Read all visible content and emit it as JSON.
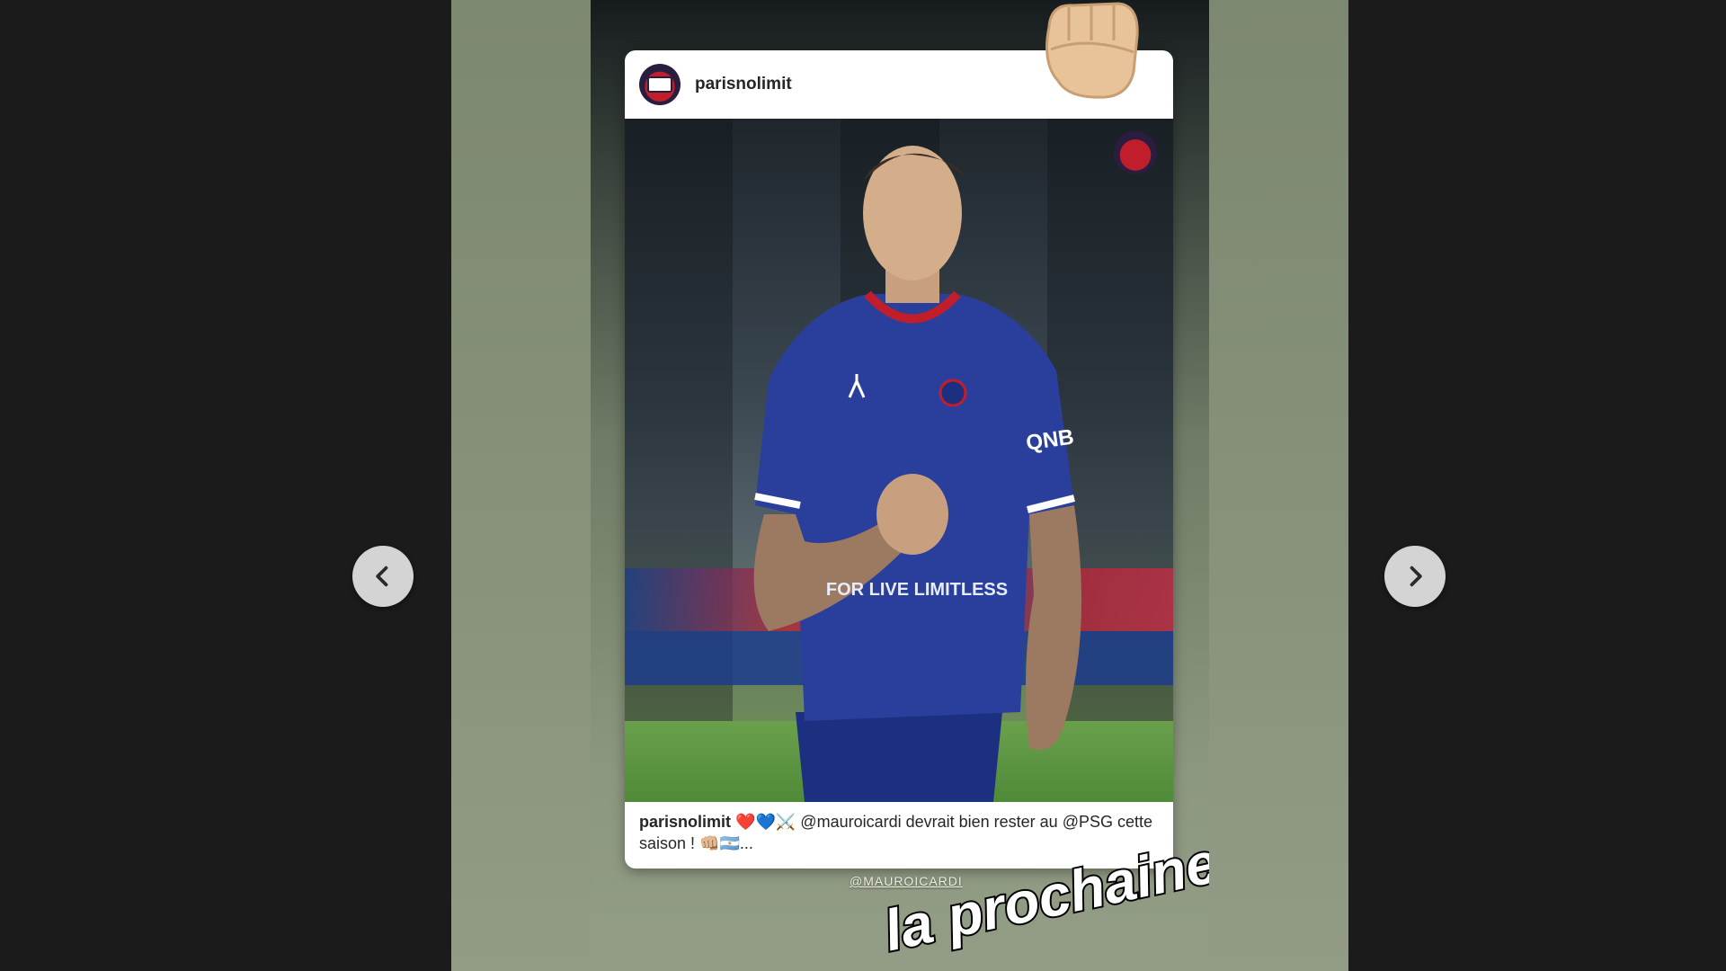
{
  "story": {
    "post": {
      "username": "parisnolimit",
      "caption_user": "parisnolimit",
      "caption_emojis_start": "❤️💙⚔️",
      "caption_text": "@mauroicardi devrait bien rester au @PSG cette saison !",
      "caption_emojis_end": "👊🏼🇦🇷...",
      "jersey_sponsor": "FOR LIVE LIMITLESS",
      "sleeve_sponsor": "QNB"
    },
    "mention_tag": "@MAUROICARDI",
    "sticker_text": "la prochaine",
    "fist_emoji": "👊🏼"
  },
  "navigation": {
    "prev_icon": "chevron-left-icon",
    "next_icon": "chevron-right-icon"
  },
  "colors": {
    "psg_blue": "#2a3f9c",
    "psg_red": "#c01e2a"
  }
}
